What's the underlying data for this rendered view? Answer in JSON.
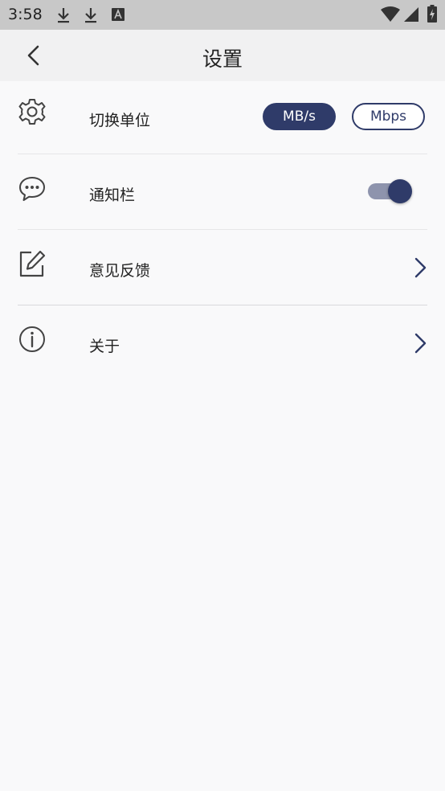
{
  "status_bar": {
    "time": "3:58",
    "icons": [
      "download-icon",
      "download-icon",
      "text-a-icon",
      "wifi-icon",
      "signal-icon",
      "battery-charging-icon"
    ]
  },
  "app_bar": {
    "title": "设置",
    "back_icon": "back-arrow-icon"
  },
  "settings": {
    "items": [
      {
        "label": "切换单位",
        "icon": "gear-icon",
        "options": [
          "MB/s",
          "Mbps"
        ],
        "selected": "MB/s"
      },
      {
        "label": "通知栏",
        "icon": "chat-bubble-icon",
        "toggle_on": true
      },
      {
        "label": "意见反馈",
        "icon": "edit-icon",
        "trailing": "chevron-right-icon"
      },
      {
        "label": "关于",
        "icon": "info-icon",
        "trailing": "chevron-right-icon"
      }
    ]
  },
  "colors": {
    "accent": "#2f3b69",
    "toggle_track": "#8e94ad",
    "background": "#f9f9fa",
    "status_bar": "#c8c8c8",
    "app_bar": "#f1f1f2"
  }
}
